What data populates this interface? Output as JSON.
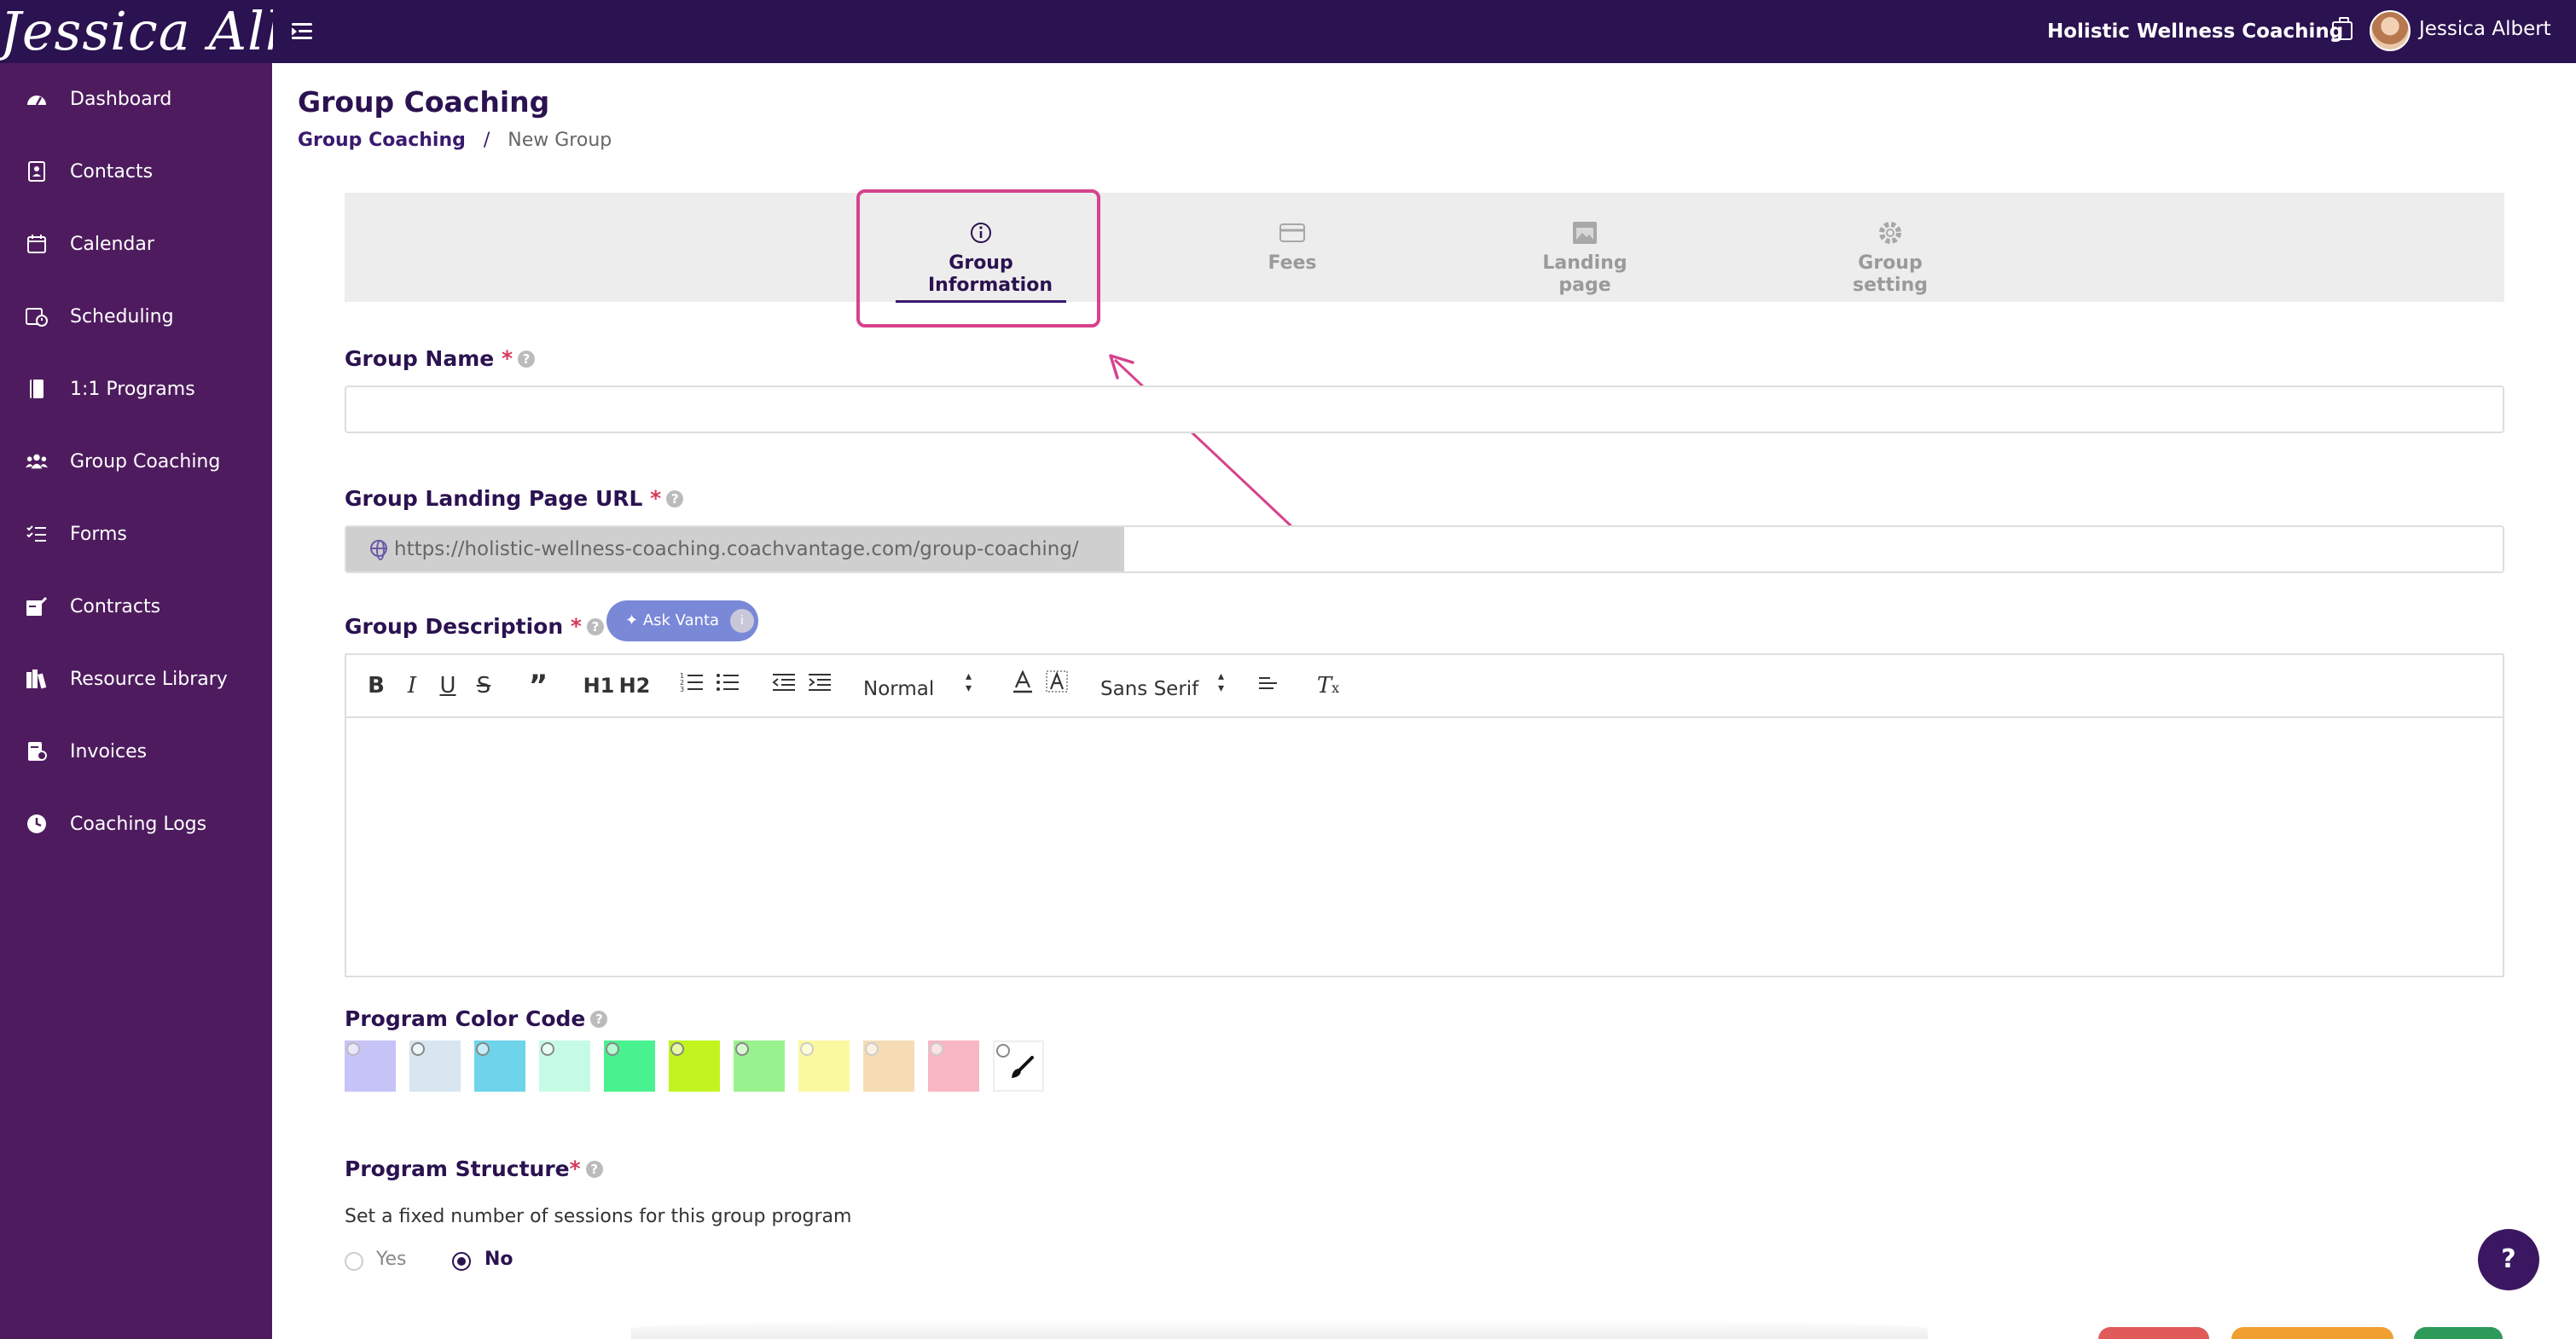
{
  "header": {
    "logo_text": "Jessica Albert",
    "business_name": "Holistic Wellness Coaching",
    "user_name": "Jessica Albert"
  },
  "sidebar": {
    "items": [
      {
        "label": "Dashboard",
        "icon": "dashboard-icon"
      },
      {
        "label": "Contacts",
        "icon": "contacts-icon"
      },
      {
        "label": "Calendar",
        "icon": "calendar-icon"
      },
      {
        "label": "Scheduling",
        "icon": "scheduling-icon"
      },
      {
        "label": "1:1 Programs",
        "icon": "book-icon"
      },
      {
        "label": "Group Coaching",
        "icon": "group-icon"
      },
      {
        "label": "Forms",
        "icon": "forms-icon"
      },
      {
        "label": "Contracts",
        "icon": "contract-icon"
      },
      {
        "label": "Resource Library",
        "icon": "library-icon"
      },
      {
        "label": "Invoices",
        "icon": "invoice-icon"
      },
      {
        "label": "Coaching Logs",
        "icon": "clock-icon"
      }
    ]
  },
  "page": {
    "title": "Group Coaching",
    "breadcrumb": {
      "link": "Group Coaching",
      "separator": "/",
      "current": "New Group"
    }
  },
  "steps": [
    {
      "label": "Group Information",
      "icon": "info-icon",
      "active": true
    },
    {
      "label": "Fees",
      "icon": "card-icon",
      "active": false
    },
    {
      "label": "Landing page",
      "icon": "image-icon",
      "active": false
    },
    {
      "label": "Group setting",
      "icon": "gear-icon",
      "active": false
    }
  ],
  "form": {
    "group_name": {
      "label": "Group Name",
      "required": "*",
      "value": ""
    },
    "landing_url": {
      "label": "Group Landing Page URL",
      "required": "*",
      "prefix": "https://holistic-wellness-coaching.coachvantage.com/group-coaching/",
      "value": ""
    },
    "description": {
      "label": "Group Description",
      "required": "*",
      "ask_button": "Ask Vanta",
      "value": ""
    },
    "editor_toolbar": {
      "heading_select": "Normal",
      "font_select": "Sans Serif",
      "h1": "H1",
      "h2": "H2"
    },
    "color_code": {
      "label": "Program Color Code",
      "swatches": [
        "#c6c4f7",
        "#d7e6f0",
        "#6dd4ea",
        "#c5fbe4",
        "#4af28f",
        "#c2f51f",
        "#98f28e",
        "#fbf9a0",
        "#f6dcb4",
        "#f8b8c3",
        "#ffffff"
      ],
      "selected_index": 0
    },
    "structure": {
      "label": "Program Structure",
      "required": "*",
      "question": "Set a fixed number of sessions for this group program",
      "options": [
        "Yes",
        "No"
      ],
      "selected": "No"
    }
  },
  "help_button": "?",
  "colors": {
    "topbar": "#2b1250",
    "sidebar": "#4e1c5e",
    "accent": "#3a1a6e",
    "annotation": "#d6438c"
  }
}
